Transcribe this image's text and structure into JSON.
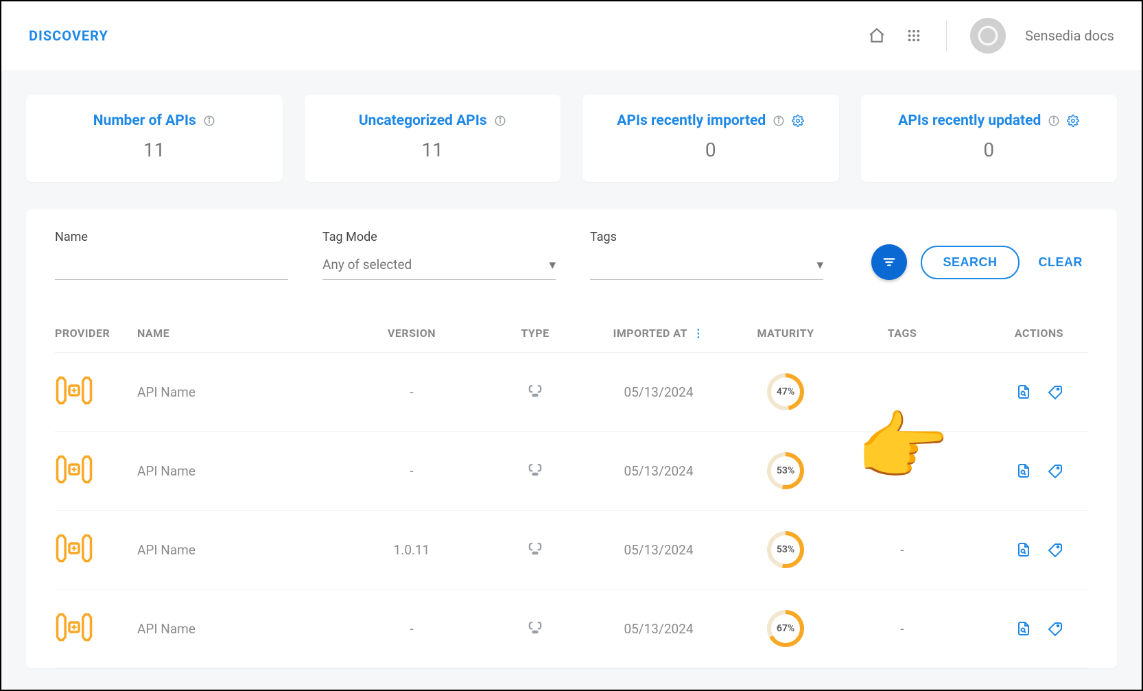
{
  "header": {
    "title": "DISCOVERY",
    "user_label": "Sensedia docs"
  },
  "stats": [
    {
      "label": "Number of APIs",
      "value": "11",
      "has_info": true,
      "has_gear": false
    },
    {
      "label": "Uncategorized APIs",
      "value": "11",
      "has_info": true,
      "has_gear": false
    },
    {
      "label": "APIs recently imported",
      "value": "0",
      "has_info": true,
      "has_gear": true
    },
    {
      "label": "APIs recently updated",
      "value": "0",
      "has_info": true,
      "has_gear": true
    }
  ],
  "filters": {
    "name_label": "Name",
    "tagmode_label": "Tag Mode",
    "tagmode_value": "Any of selected",
    "tags_label": "Tags",
    "search_label": "SEARCH",
    "clear_label": "CLEAR"
  },
  "columns": {
    "provider": "PROVIDER",
    "name": "NAME",
    "version": "VERSION",
    "type": "TYPE",
    "imported_at": "IMPORTED AT",
    "maturity": "MATURITY",
    "tags": "TAGS",
    "actions": "ACTIONS"
  },
  "rows": [
    {
      "name": "API Name",
      "version": "-",
      "imported_at": "05/13/2024",
      "maturity": 47,
      "tags": ""
    },
    {
      "name": "API Name",
      "version": "-",
      "imported_at": "05/13/2024",
      "maturity": 53,
      "tags": "-"
    },
    {
      "name": "API Name",
      "version": "1.0.11",
      "imported_at": "05/13/2024",
      "maturity": 53,
      "tags": "-"
    },
    {
      "name": "API Name",
      "version": "-",
      "imported_at": "05/13/2024",
      "maturity": 67,
      "tags": "-"
    }
  ]
}
